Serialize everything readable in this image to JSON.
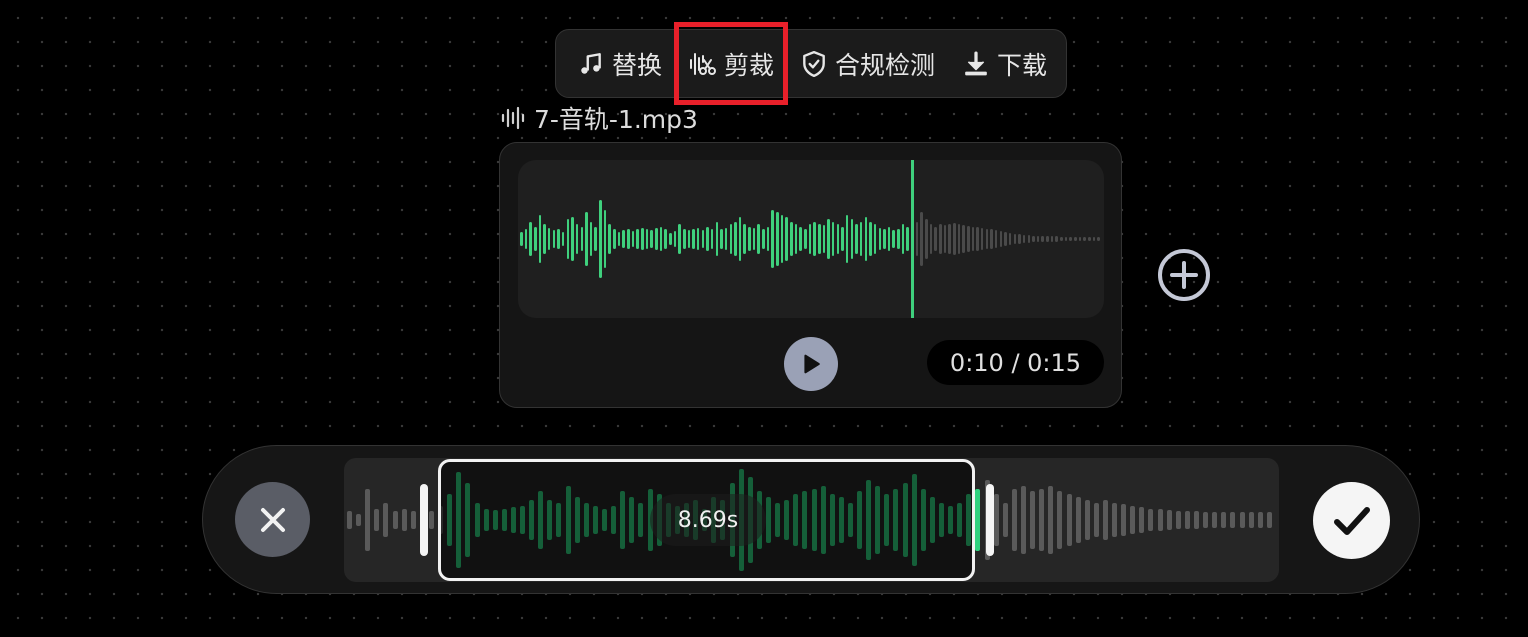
{
  "toolbar": {
    "items": [
      {
        "label": "替换",
        "icon": "music-note-icon"
      },
      {
        "label": "剪裁",
        "icon": "audio-scissors-icon",
        "selected": true
      },
      {
        "label": "合规检测",
        "icon": "shield-check-icon"
      },
      {
        "label": "下载",
        "icon": "download-icon"
      }
    ]
  },
  "file": {
    "icon": "audio-waveform-icon",
    "name": "7-音轨-1.mp3"
  },
  "player": {
    "time": "0:10 / 0:15",
    "progress": 0.667,
    "play_icon": "play-icon",
    "wave_heights": [
      0.15,
      0.2,
      0.35,
      0.25,
      0.5,
      0.3,
      0.22,
      0.18,
      0.2,
      0.15,
      0.4,
      0.45,
      0.3,
      0.25,
      0.55,
      0.35,
      0.25,
      0.8,
      0.6,
      0.3,
      0.2,
      0.15,
      0.18,
      0.2,
      0.16,
      0.2,
      0.22,
      0.2,
      0.18,
      0.22,
      0.25,
      0.2,
      0.12,
      0.16,
      0.3,
      0.2,
      0.18,
      0.2,
      0.22,
      0.18,
      0.25,
      0.2,
      0.35,
      0.2,
      0.22,
      0.3,
      0.35,
      0.45,
      0.3,
      0.25,
      0.22,
      0.3,
      0.2,
      0.25,
      0.6,
      0.55,
      0.5,
      0.45,
      0.35,
      0.3,
      0.25,
      0.2,
      0.3,
      0.35,
      0.3,
      0.28,
      0.4,
      0.35,
      0.3,
      0.25,
      0.5,
      0.4,
      0.3,
      0.35,
      0.45,
      0.35,
      0.3,
      0.22,
      0.2,
      0.25,
      0.18,
      0.2,
      0.3,
      0.25,
      0.22,
      0.35,
      0.55,
      0.4,
      0.3,
      0.25,
      0.3,
      0.28,
      0.3,
      0.32,
      0.3,
      0.28,
      0.26,
      0.24,
      0.25,
      0.22,
      0.2,
      0.2,
      0.18,
      0.16,
      0.14,
      0.12,
      0.1,
      0.1,
      0.08,
      0.08,
      0.07,
      0.07,
      0.06,
      0.06,
      0.06,
      0.06,
      0.05,
      0.05,
      0.05,
      0.05,
      0.05,
      0.05,
      0.05,
      0.05,
      0.05
    ],
    "colors": {
      "played": "#3fd07d",
      "unplayed": "#4a4a4a"
    }
  },
  "add_icon": "plus-circle-icon",
  "trim": {
    "duration": "8.69s",
    "cancel_icon": "close-icon",
    "confirm_icon": "check-icon",
    "wave_heights": [
      0.15,
      0.1,
      0.55,
      0.2,
      0.3,
      0.15,
      0.2,
      0.15,
      0.35,
      0.15,
      0.25,
      0.45,
      0.85,
      0.65,
      0.3,
      0.2,
      0.18,
      0.2,
      0.22,
      0.25,
      0.35,
      0.5,
      0.35,
      0.3,
      0.6,
      0.4,
      0.3,
      0.25,
      0.2,
      0.25,
      0.5,
      0.4,
      0.3,
      0.55,
      0.45,
      0.3,
      0.25,
      0.3,
      0.35,
      0.2,
      0.4,
      0.35,
      0.65,
      0.9,
      0.75,
      0.5,
      0.4,
      0.3,
      0.35,
      0.45,
      0.5,
      0.55,
      0.6,
      0.45,
      0.4,
      0.3,
      0.5,
      0.7,
      0.6,
      0.45,
      0.55,
      0.65,
      0.8,
      0.55,
      0.4,
      0.3,
      0.25,
      0.3,
      0.45,
      0.55,
      0.7,
      0.45,
      0.3,
      0.55,
      0.6,
      0.5,
      0.55,
      0.6,
      0.5,
      0.45,
      0.4,
      0.35,
      0.3,
      0.35,
      0.3,
      0.28,
      0.25,
      0.22,
      0.2,
      0.2,
      0.18,
      0.16,
      0.15,
      0.15,
      0.14,
      0.14,
      0.14,
      0.14,
      0.14,
      0.14,
      0.14,
      0.14
    ],
    "selection": {
      "start": 0.101,
      "end": 0.678
    },
    "colors": {
      "selected": "#2fd27f",
      "unselected": "#5a5a5a"
    }
  }
}
